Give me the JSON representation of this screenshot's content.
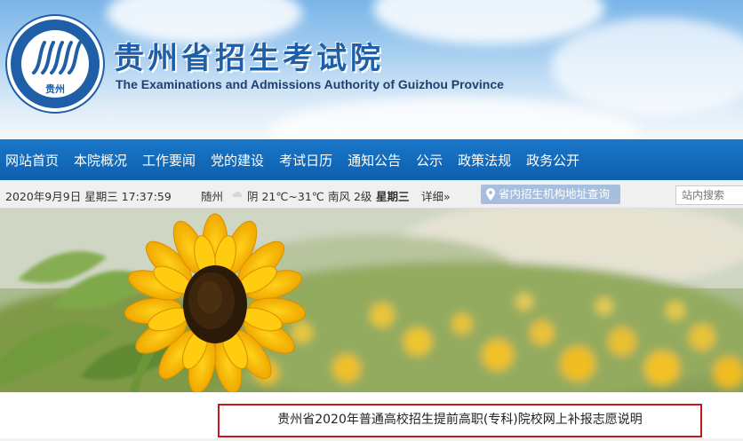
{
  "header": {
    "logo_text": "贵州",
    "site_title": "贵州省招生考试院",
    "site_subtitle": "The Examinations and Admissions Authority of Guizhou Province"
  },
  "nav": {
    "items": [
      "网站首页",
      "本院概况",
      "工作要闻",
      "党的建设",
      "考试日历",
      "通知公告",
      "公示",
      "政策法规",
      "政务公开"
    ]
  },
  "infobar": {
    "datetime": "2020年9月9日  星期三  17:37:59",
    "city": "随州",
    "weather": "阴 21℃~31℃",
    "wind": "南风 2级",
    "weekday": "星期三",
    "detail_link": "详细»",
    "address_button": "省内招生机构地址查询",
    "search_placeholder": "站内搜索"
  },
  "notice": {
    "title": "贵州省2020年普通高校招生提前高职(专科)院校网上补报志愿说明"
  },
  "colors": {
    "nav_bg": "#0d5fad",
    "brand_blue": "#1f5fa8",
    "notice_border": "#c8161d"
  }
}
